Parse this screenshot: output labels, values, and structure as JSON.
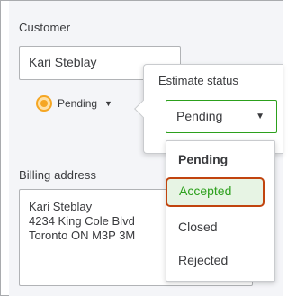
{
  "customer": {
    "label": "Customer",
    "value": "Kari Steblay"
  },
  "status_indicator": {
    "text": "Pending",
    "icon": "clock-icon",
    "color": "#f5a623"
  },
  "billing": {
    "label": "Billing address",
    "lines": [
      "Kari Steblay",
      "4234 King Cole Blvd",
      "Toronto ON  M3P 3M"
    ]
  },
  "popover": {
    "title": "Estimate status",
    "selected": "Pending"
  },
  "dropdown": {
    "options": [
      "Pending",
      "Accepted",
      "Closed",
      "Rejected"
    ],
    "highlighted": "Accepted"
  },
  "colors": {
    "accent_green": "#2ca01c",
    "highlight_border": "#c1440e"
  }
}
